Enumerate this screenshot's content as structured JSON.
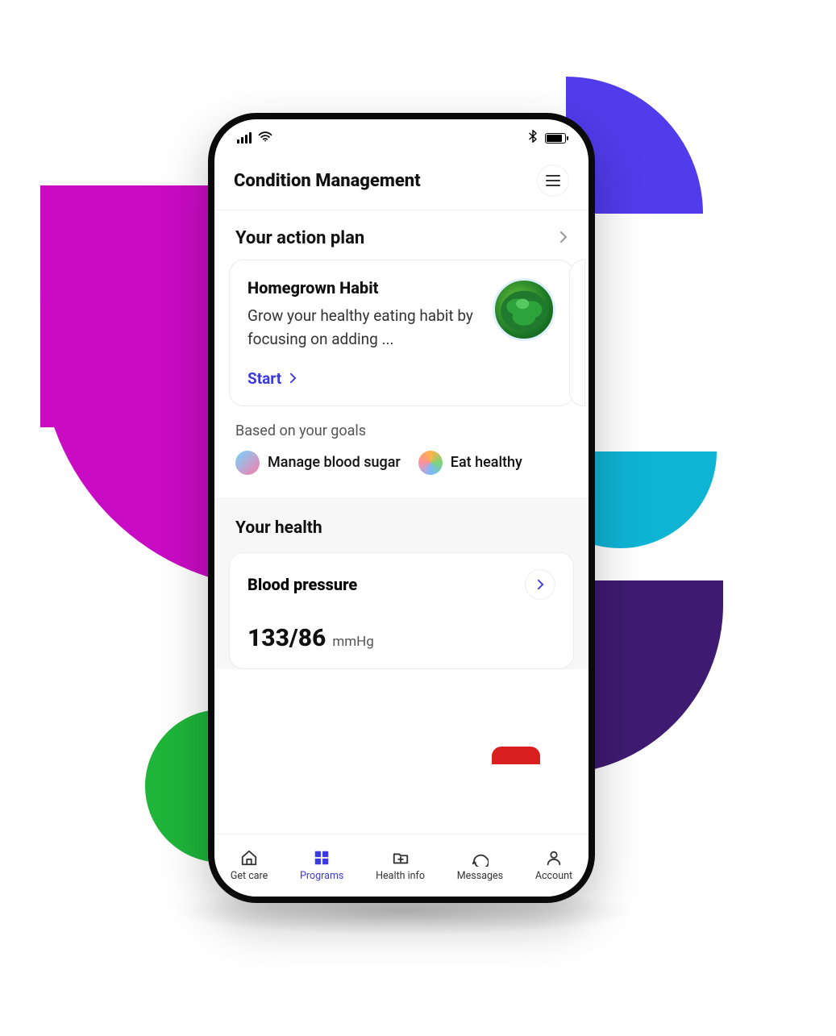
{
  "statusbar": {
    "signal_icon": "cell-signal-icon",
    "wifi_icon": "wifi-icon",
    "bluetooth_icon": "bluetooth-icon",
    "battery_icon": "battery-icon"
  },
  "header": {
    "title": "Condition Management",
    "menu_icon": "hamburger-icon"
  },
  "action_plan": {
    "heading": "Your action plan",
    "card": {
      "title": "Homegrown Habit",
      "body": "Grow your healthy eating habit by focusing on adding ...",
      "cta": "Start",
      "image_alt": "spinach-bowl"
    }
  },
  "goals": {
    "label": "Based on your goals",
    "items": [
      {
        "label": "Manage blood sugar"
      },
      {
        "label": "Eat healthy"
      }
    ]
  },
  "health": {
    "heading": "Your health",
    "card": {
      "title": "Blood pressure",
      "value": "133/86",
      "unit": "mmHg"
    }
  },
  "tabs": [
    {
      "label": "Get care",
      "icon": "home-icon",
      "active": false
    },
    {
      "label": "Programs",
      "icon": "grid-icon",
      "active": true
    },
    {
      "label": "Health info",
      "icon": "folder-plus-icon",
      "active": false
    },
    {
      "label": "Messages",
      "icon": "chat-icon",
      "active": false
    },
    {
      "label": "Account",
      "icon": "person-icon",
      "active": false
    }
  ],
  "colors": {
    "accent": "#3B39E0",
    "magenta": "#C90BC3",
    "teal": "#0FB3D4",
    "green": "#1EB53A",
    "deepPurple": "#3E1B71",
    "red": "#d9201f"
  }
}
